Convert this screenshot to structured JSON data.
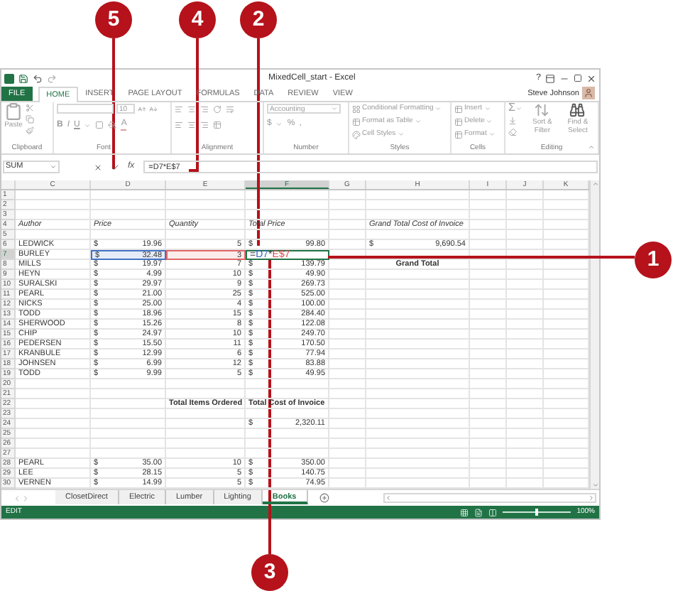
{
  "window": {
    "title": "MixedCell_start - Excel",
    "help": "?"
  },
  "ribbon_tabs": [
    {
      "label": "FILE",
      "kind": "file",
      "selected": false
    },
    {
      "label": "HOME",
      "kind": "tab",
      "selected": true
    },
    {
      "label": "INSERT",
      "kind": "tab",
      "selected": false
    },
    {
      "label": "PAGE LAYOUT",
      "kind": "tab",
      "selected": false
    },
    {
      "label": "FORMULAS",
      "kind": "tab",
      "selected": false
    },
    {
      "label": "DATA",
      "kind": "tab",
      "selected": false
    },
    {
      "label": "REVIEW",
      "kind": "tab",
      "selected": false
    },
    {
      "label": "VIEW",
      "kind": "tab",
      "selected": false
    }
  ],
  "user": {
    "name": "Steve Johnson"
  },
  "ribbon": {
    "groups": [
      {
        "kind": "clipboard",
        "label": "Clipboard",
        "paste": "Paste"
      },
      {
        "kind": "font",
        "label": "Font",
        "size": "10",
        "bold": "B",
        "italic": "I",
        "underline": "U",
        "color_letter": "A"
      },
      {
        "kind": "alignment",
        "label": "Alignment"
      },
      {
        "kind": "number",
        "label": "Number",
        "format": "Accounting",
        "currency": "$",
        "percent": "%",
        "comma": ","
      },
      {
        "kind": "styles",
        "label": "Styles",
        "commands": [
          "Conditional Formatting",
          "Format as Table",
          "Cell Styles"
        ]
      },
      {
        "kind": "cells",
        "label": "Cells",
        "commands": [
          "Insert",
          "Delete",
          "Format"
        ]
      },
      {
        "kind": "editing",
        "label": "Editing",
        "sum": "Σ",
        "commands": [
          "Sort & Filter",
          "Find & Select"
        ]
      }
    ]
  },
  "formula_bar": {
    "name_box": "SUM",
    "function_label": "fx",
    "formula": "=D7*E$7"
  },
  "columns": [
    {
      "label": "C",
      "selected": false
    },
    {
      "label": "D",
      "selected": false
    },
    {
      "label": "E",
      "selected": false
    },
    {
      "label": "F",
      "selected": true
    },
    {
      "label": "G",
      "selected": false
    },
    {
      "label": "H",
      "selected": false
    },
    {
      "label": "I",
      "selected": false
    },
    {
      "label": "J",
      "selected": false
    },
    {
      "label": "K",
      "selected": false
    }
  ],
  "rows": [
    {
      "number": "1",
      "selected": false
    },
    {
      "number": "2",
      "selected": false
    },
    {
      "number": "3",
      "selected": false
    },
    {
      "number": "4",
      "selected": false,
      "C": {
        "kind": "italic",
        "text": "Author"
      },
      "D": {
        "kind": "italic",
        "text": "Price"
      },
      "E": {
        "kind": "italic",
        "text": "Quantity"
      },
      "F": {
        "kind": "italic",
        "text": "Total Price"
      },
      "H": {
        "kind": "italic",
        "text": "Grand Total Cost of Invoice"
      }
    },
    {
      "number": "5",
      "selected": false
    },
    {
      "number": "6",
      "selected": false,
      "C": {
        "kind": "text",
        "text": "LEDWICK"
      },
      "D": {
        "kind": "money",
        "currency": "$",
        "text": "19.96"
      },
      "E": {
        "kind": "number",
        "text": "5"
      },
      "F": {
        "kind": "money",
        "currency": "$",
        "text": "99.80"
      },
      "H": {
        "kind": "money",
        "currency": "$",
        "text": "9,690.54"
      }
    },
    {
      "number": "7",
      "selected": true,
      "C": {
        "kind": "text",
        "text": "BURLEY"
      },
      "D": {
        "kind": "money",
        "currency": "$",
        "text": "32.48",
        "color": "#4472c4"
      },
      "E": {
        "kind": "number",
        "text": "3",
        "color": "#e06666"
      },
      "F": {
        "kind": "formula",
        "parts": [
          {
            "text": "="
          },
          {
            "text": "D7",
            "color": "#2f5fc4"
          },
          {
            "text": "*"
          },
          {
            "text": "E$7",
            "color": "#d64545"
          }
        ]
      }
    },
    {
      "number": "8",
      "selected": false,
      "C": {
        "kind": "text",
        "text": "MILLS"
      },
      "D": {
        "kind": "money",
        "currency": "$",
        "text": "19.97"
      },
      "E": {
        "kind": "number",
        "text": "7"
      },
      "F": {
        "kind": "money",
        "currency": "$",
        "text": "139.79"
      },
      "H": {
        "kind": "title",
        "text": "Grand Total"
      }
    },
    {
      "number": "9",
      "selected": false,
      "C": {
        "kind": "text",
        "text": "HEYN"
      },
      "D": {
        "kind": "money",
        "currency": "$",
        "text": "4.99"
      },
      "E": {
        "kind": "number",
        "text": "10"
      },
      "F": {
        "kind": "money",
        "currency": "$",
        "text": "49.90"
      }
    },
    {
      "number": "10",
      "selected": false,
      "C": {
        "kind": "text",
        "text": "SURALSKI"
      },
      "D": {
        "kind": "money",
        "currency": "$",
        "text": "29.97"
      },
      "E": {
        "kind": "number",
        "text": "9"
      },
      "F": {
        "kind": "money",
        "currency": "$",
        "text": "269.73"
      }
    },
    {
      "number": "11",
      "selected": false,
      "C": {
        "kind": "text",
        "text": "PEARL"
      },
      "D": {
        "kind": "money",
        "currency": "$",
        "text": "21.00"
      },
      "E": {
        "kind": "number",
        "text": "25"
      },
      "F": {
        "kind": "money",
        "currency": "$",
        "text": "525.00"
      }
    },
    {
      "number": "12",
      "selected": false,
      "C": {
        "kind": "text",
        "text": "NICKS"
      },
      "D": {
        "kind": "money",
        "currency": "$",
        "text": "25.00"
      },
      "E": {
        "kind": "number",
        "text": "4"
      },
      "F": {
        "kind": "money",
        "currency": "$",
        "text": "100.00"
      }
    },
    {
      "number": "13",
      "selected": false,
      "C": {
        "kind": "text",
        "text": "TODD"
      },
      "D": {
        "kind": "money",
        "currency": "$",
        "text": "18.96"
      },
      "E": {
        "kind": "number",
        "text": "15"
      },
      "F": {
        "kind": "money",
        "currency": "$",
        "text": "284.40"
      }
    },
    {
      "number": "14",
      "selected": false,
      "C": {
        "kind": "text",
        "text": "SHERWOOD"
      },
      "D": {
        "kind": "money",
        "currency": "$",
        "text": "15.26"
      },
      "E": {
        "kind": "number",
        "text": "8"
      },
      "F": {
        "kind": "money",
        "currency": "$",
        "text": "122.08"
      }
    },
    {
      "number": "15",
      "selected": false,
      "C": {
        "kind": "text",
        "text": "CHIP"
      },
      "D": {
        "kind": "money",
        "currency": "$",
        "text": "24.97"
      },
      "E": {
        "kind": "number",
        "text": "10"
      },
      "F": {
        "kind": "money",
        "currency": "$",
        "text": "249.70"
      }
    },
    {
      "number": "16",
      "selected": false,
      "C": {
        "kind": "text",
        "text": "PEDERSEN"
      },
      "D": {
        "kind": "money",
        "currency": "$",
        "text": "15.50"
      },
      "E": {
        "kind": "number",
        "text": "11"
      },
      "F": {
        "kind": "money",
        "currency": "$",
        "text": "170.50"
      }
    },
    {
      "number": "17",
      "selected": false,
      "C": {
        "kind": "text",
        "text": "KRANBULE"
      },
      "D": {
        "kind": "money",
        "currency": "$",
        "text": "12.99"
      },
      "E": {
        "kind": "number",
        "text": "6"
      },
      "F": {
        "kind": "money",
        "currency": "$",
        "text": "77.94"
      }
    },
    {
      "number": "18",
      "selected": false,
      "C": {
        "kind": "text",
        "text": "JOHNSEN"
      },
      "D": {
        "kind": "money",
        "currency": "$",
        "text": "6.99"
      },
      "E": {
        "kind": "number",
        "text": "12"
      },
      "F": {
        "kind": "money",
        "currency": "$",
        "text": "83.88"
      }
    },
    {
      "number": "19",
      "selected": false,
      "C": {
        "kind": "text",
        "text": "TODD"
      },
      "D": {
        "kind": "money",
        "currency": "$",
        "text": "9.99"
      },
      "E": {
        "kind": "number",
        "text": "5"
      },
      "F": {
        "kind": "money",
        "currency": "$",
        "text": "49.95"
      }
    },
    {
      "number": "20",
      "selected": false
    },
    {
      "number": "21",
      "selected": false
    },
    {
      "number": "22",
      "selected": false,
      "E": {
        "kind": "bold",
        "text": "Total Items Ordered"
      },
      "F": {
        "kind": "bold",
        "text": "Total Cost of Invoice"
      }
    },
    {
      "number": "23",
      "selected": false
    },
    {
      "number": "24",
      "selected": false,
      "F": {
        "kind": "money",
        "currency": "$",
        "text": "2,320.11"
      }
    },
    {
      "number": "25",
      "selected": false
    },
    {
      "number": "26",
      "selected": false
    },
    {
      "number": "27",
      "selected": false
    },
    {
      "number": "28",
      "selected": false,
      "C": {
        "kind": "text",
        "text": "PEARL"
      },
      "D": {
        "kind": "money",
        "currency": "$",
        "text": "35.00"
      },
      "E": {
        "kind": "number",
        "text": "10"
      },
      "F": {
        "kind": "money",
        "currency": "$",
        "text": "350.00"
      }
    },
    {
      "number": "29",
      "selected": false,
      "C": {
        "kind": "text",
        "text": "LEE"
      },
      "D": {
        "kind": "money",
        "currency": "$",
        "text": "28.15"
      },
      "E": {
        "kind": "number",
        "text": "5"
      },
      "F": {
        "kind": "money",
        "currency": "$",
        "text": "140.75"
      }
    },
    {
      "number": "30",
      "selected": false,
      "C": {
        "kind": "text",
        "text": "VERNEN"
      },
      "D": {
        "kind": "money",
        "currency": "$",
        "text": "14.99"
      },
      "E": {
        "kind": "number",
        "text": "5"
      },
      "F": {
        "kind": "money",
        "currency": "$",
        "text": "74.95"
      }
    }
  ],
  "sheet_tabs": [
    {
      "label": "ClosetDirect",
      "selected": false
    },
    {
      "label": "Electric",
      "selected": false
    },
    {
      "label": "Lumber",
      "selected": false
    },
    {
      "label": "Lighting",
      "selected": false
    },
    {
      "label": "Books",
      "selected": true
    }
  ],
  "status_bar": {
    "mode": "EDIT",
    "zoom_slider": {
      "level": 0.5
    },
    "zoom": "100%"
  },
  "callouts": [
    {
      "label": "5"
    },
    {
      "label": "4"
    },
    {
      "label": "2"
    },
    {
      "label": "1"
    },
    {
      "label": "3"
    }
  ]
}
